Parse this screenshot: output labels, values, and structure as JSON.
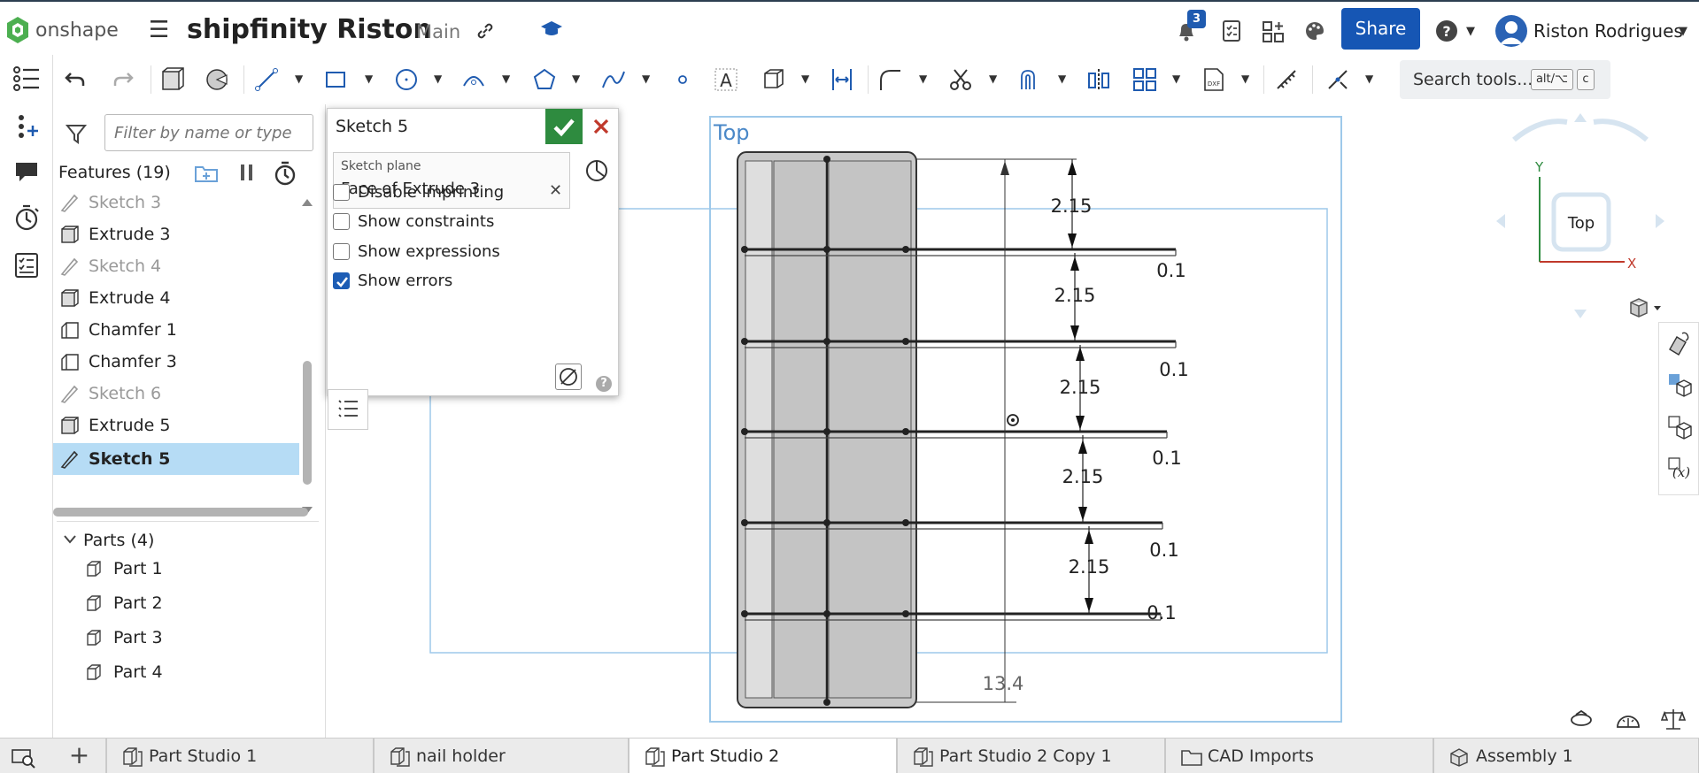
{
  "app": {
    "name": "onshape",
    "brand_color": "#1656b4"
  },
  "document": {
    "title": "shipfinity Riston",
    "branch": "Main"
  },
  "header": {
    "notification_count": "3",
    "share_label": "Share",
    "user_name": "Riston Rodrigues"
  },
  "toolbar": {
    "search_label": "Search tools...",
    "shortcut_key1": "alt/⌥",
    "shortcut_key2": "c"
  },
  "feature_panel": {
    "filter_placeholder": "Filter by name or type",
    "features_header": "Features (19)",
    "features": [
      {
        "label": "Sketch 3",
        "icon": "sketch-icon",
        "dim": true
      },
      {
        "label": "Extrude 3",
        "icon": "extrude-icon",
        "dim": false
      },
      {
        "label": "Sketch 4",
        "icon": "sketch-icon",
        "dim": true
      },
      {
        "label": "Extrude 4",
        "icon": "extrude-icon",
        "dim": false
      },
      {
        "label": "Chamfer 1",
        "icon": "chamfer-icon",
        "dim": false
      },
      {
        "label": "Chamfer 3",
        "icon": "chamfer-icon",
        "dim": false
      },
      {
        "label": "Sketch 6",
        "icon": "sketch-icon",
        "dim": true
      },
      {
        "label": "Extrude 5",
        "icon": "extrude-icon",
        "dim": false
      },
      {
        "label": "Sketch 5",
        "icon": "sketch-icon",
        "selected": true
      }
    ],
    "parts_header": "Parts (4)",
    "parts": [
      {
        "label": "Part 1"
      },
      {
        "label": "Part 2"
      },
      {
        "label": "Part 3"
      },
      {
        "label": "Part 4"
      }
    ]
  },
  "sketch_dialog": {
    "title": "Sketch 5",
    "plane_label": "Sketch plane",
    "plane_value": "Face of Extrude 3",
    "options": [
      {
        "label": "Disable imprinting",
        "checked": false
      },
      {
        "label": "Show constraints",
        "checked": false
      },
      {
        "label": "Show expressions",
        "checked": false
      },
      {
        "label": "Show errors",
        "checked": true
      }
    ],
    "help": "?"
  },
  "viewport": {
    "plane_label": "Top",
    "dimensions": [
      "2.15",
      "2.15",
      "2.15",
      "2.15",
      "2.15"
    ],
    "thickness_dims": [
      "0.1",
      "0.1",
      "0.1",
      "0.1",
      "0.1"
    ],
    "overall_dim": "13.4",
    "view_cube": {
      "face_label": "Top",
      "axis_y": "Y",
      "axis_x": "X"
    }
  },
  "tabs": [
    {
      "label": "Part Studio 1",
      "icon": "part-studio-icon",
      "active": false
    },
    {
      "label": "nail holder",
      "icon": "part-studio-icon",
      "active": false
    },
    {
      "label": "Part Studio 2",
      "icon": "part-studio-icon",
      "active": true
    },
    {
      "label": "Part Studio 2 Copy 1",
      "icon": "part-studio-icon",
      "active": false
    },
    {
      "label": "CAD Imports",
      "icon": "folder-icon",
      "active": false
    },
    {
      "label": "Assembly 1",
      "icon": "assembly-icon",
      "active": false
    }
  ]
}
